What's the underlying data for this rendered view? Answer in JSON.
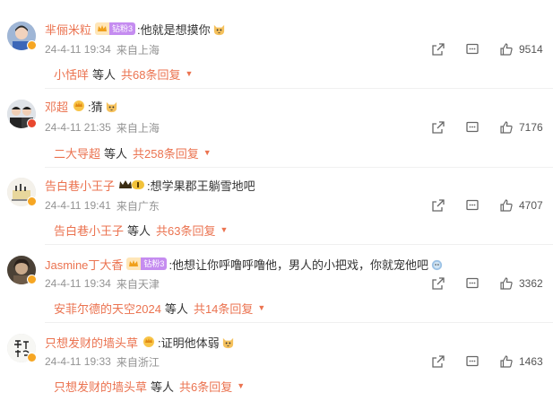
{
  "comments": [
    {
      "user": "芈俪米粒",
      "fan_level": "钻粉3",
      "text": ":他就是想摸你",
      "date": "24-4-11 19:34",
      "location": "来自上海",
      "likes": "9514",
      "reply_user": "小恬咩",
      "reply_mid": "等人",
      "reply_count": "共68条回复",
      "badge_color": "#f6a623",
      "emoji": "cat-face"
    },
    {
      "user": "邓超",
      "text": ":猜",
      "date": "24-4-11 21:35",
      "location": "来自上海",
      "likes": "7176",
      "reply_user": "二大导超",
      "reply_mid": "等人",
      "reply_count": "共258条回复",
      "badge_color": "#e8472e",
      "emoji": "cat-face"
    },
    {
      "user": "告白巷小王子",
      "text": ":想学果郡王躺雪地吧",
      "date": "24-4-11 19:41",
      "location": "来自广东",
      "likes": "4707",
      "reply_user": "告白巷小王子",
      "reply_mid": "等人",
      "reply_count": "共63条回复",
      "badge_color": "#f6a623",
      "emoji": ""
    },
    {
      "user": "Jasmine丁大香",
      "fan_level": "钻粉3",
      "text": ":他想让你呼噜呼噜他，男人的小把戏，你就宠他吧",
      "date": "24-4-11 19:34",
      "location": "来自天津",
      "likes": "3362",
      "reply_user": "安菲尔德的天空2024",
      "reply_mid": "等人",
      "reply_count": "共14条回复",
      "badge_color": "#f6a623",
      "emoji": "lion-face"
    },
    {
      "user": "只想发财的墙头草",
      "text": ":证明他体弱",
      "date": "24-4-11 19:33",
      "location": "来自浙江",
      "likes": "1463",
      "reply_user": "只想发财的墙头草",
      "reply_mid": "等人",
      "reply_count": "共6条回复",
      "badge_color": "#f6a623",
      "emoji": "cat-face"
    }
  ],
  "icons": {
    "share": "share-icon",
    "comment": "comment-icon",
    "like": "thumbs-up-icon"
  },
  "colors": {
    "accent": "#eb7350",
    "meta": "#939393"
  }
}
